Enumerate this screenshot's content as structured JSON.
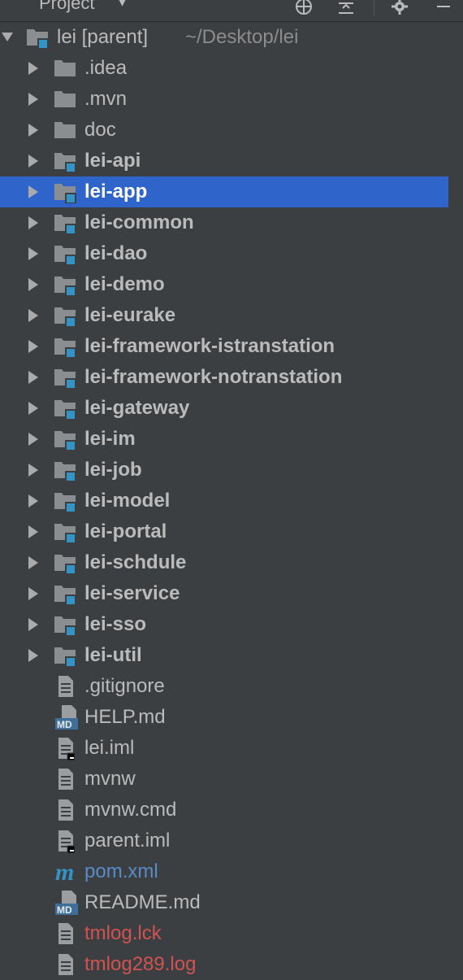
{
  "header": {
    "title": "Project"
  },
  "root": {
    "label": "lei [parent]",
    "path": "~/Desktop/lei"
  },
  "folders": [
    {
      "label": ".idea",
      "module": false,
      "selected": false
    },
    {
      "label": ".mvn",
      "module": false,
      "selected": false
    },
    {
      "label": "doc",
      "module": false,
      "selected": false
    },
    {
      "label": "lei-api",
      "module": true,
      "selected": false
    },
    {
      "label": "lei-app",
      "module": true,
      "selected": true
    },
    {
      "label": "lei-common",
      "module": true,
      "selected": false
    },
    {
      "label": "lei-dao",
      "module": true,
      "selected": false
    },
    {
      "label": "lei-demo",
      "module": true,
      "selected": false
    },
    {
      "label": "lei-eurake",
      "module": true,
      "selected": false
    },
    {
      "label": "lei-framework-istranstation",
      "module": true,
      "selected": false
    },
    {
      "label": "lei-framework-notranstation",
      "module": true,
      "selected": false
    },
    {
      "label": "lei-gateway",
      "module": true,
      "selected": false
    },
    {
      "label": "lei-im",
      "module": true,
      "selected": false
    },
    {
      "label": "lei-job",
      "module": true,
      "selected": false
    },
    {
      "label": "lei-model",
      "module": true,
      "selected": false
    },
    {
      "label": "lei-portal",
      "module": true,
      "selected": false
    },
    {
      "label": "lei-schdule",
      "module": true,
      "selected": false
    },
    {
      "label": "lei-service",
      "module": true,
      "selected": false
    },
    {
      "label": "lei-sso",
      "module": true,
      "selected": false
    },
    {
      "label": "lei-util",
      "module": true,
      "selected": false
    }
  ],
  "files": [
    {
      "label": ".gitignore",
      "icon": "text-file-icon",
      "color": "default"
    },
    {
      "label": "HELP.md",
      "icon": "markdown-file-icon",
      "color": "default"
    },
    {
      "label": "lei.iml",
      "icon": "iml-file-icon",
      "color": "default"
    },
    {
      "label": "mvnw",
      "icon": "text-file-icon",
      "color": "default"
    },
    {
      "label": "mvnw.cmd",
      "icon": "text-file-icon",
      "color": "default"
    },
    {
      "label": "parent.iml",
      "icon": "iml-file-icon",
      "color": "default"
    },
    {
      "label": "pom.xml",
      "icon": "maven-icon",
      "color": "blue"
    },
    {
      "label": "README.md",
      "icon": "markdown-file-icon",
      "color": "default"
    },
    {
      "label": "tmlog.lck",
      "icon": "text-file-icon",
      "color": "red"
    },
    {
      "label": "tmlog289.log",
      "icon": "text-file-icon",
      "color": "red"
    }
  ],
  "colors": {
    "background": "#3c3f41",
    "selection": "#2f65ca",
    "module_badge": "#3592c4",
    "vcs_blue": "#5a8ac8",
    "vcs_red": "#d25252"
  }
}
